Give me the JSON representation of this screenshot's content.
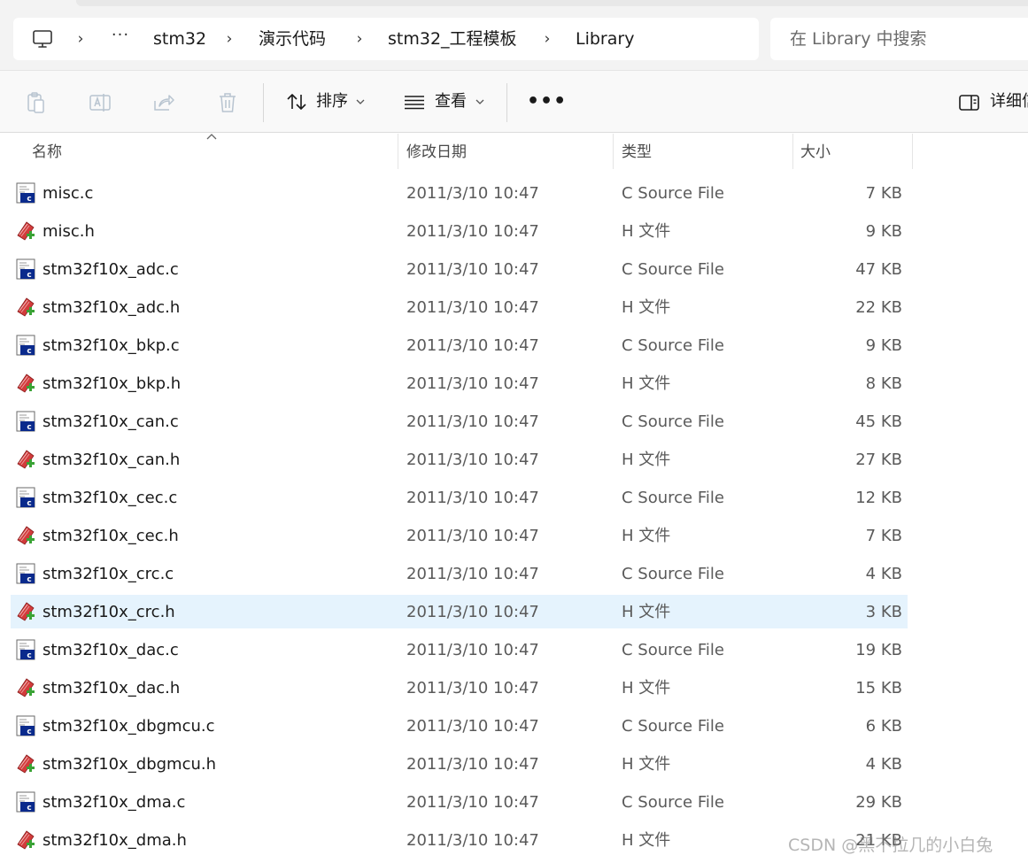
{
  "address": {
    "crumbs": [
      "stm32",
      "演示代码",
      "stm32_工程模板",
      "Library"
    ],
    "ellipsis": "···",
    "separator": "›"
  },
  "search": {
    "placeholder": "在 Library 中搜索"
  },
  "toolbar": {
    "sort_label": "排序",
    "view_label": "查看",
    "more_label": "•••",
    "details_label": "详细信息"
  },
  "columns": {
    "name": "名称",
    "date": "修改日期",
    "type": "类型",
    "size": "大小"
  },
  "files": [
    {
      "name": "misc.c",
      "date": "2011/3/10 10:47",
      "type": "C Source File",
      "size": "7 KB",
      "kind": "c"
    },
    {
      "name": "misc.h",
      "date": "2011/3/10 10:47",
      "type": "H 文件",
      "size": "9 KB",
      "kind": "h"
    },
    {
      "name": "stm32f10x_adc.c",
      "date": "2011/3/10 10:47",
      "type": "C Source File",
      "size": "47 KB",
      "kind": "c"
    },
    {
      "name": "stm32f10x_adc.h",
      "date": "2011/3/10 10:47",
      "type": "H 文件",
      "size": "22 KB",
      "kind": "h"
    },
    {
      "name": "stm32f10x_bkp.c",
      "date": "2011/3/10 10:47",
      "type": "C Source File",
      "size": "9 KB",
      "kind": "c"
    },
    {
      "name": "stm32f10x_bkp.h",
      "date": "2011/3/10 10:47",
      "type": "H 文件",
      "size": "8 KB",
      "kind": "h"
    },
    {
      "name": "stm32f10x_can.c",
      "date": "2011/3/10 10:47",
      "type": "C Source File",
      "size": "45 KB",
      "kind": "c"
    },
    {
      "name": "stm32f10x_can.h",
      "date": "2011/3/10 10:47",
      "type": "H 文件",
      "size": "27 KB",
      "kind": "h"
    },
    {
      "name": "stm32f10x_cec.c",
      "date": "2011/3/10 10:47",
      "type": "C Source File",
      "size": "12 KB",
      "kind": "c"
    },
    {
      "name": "stm32f10x_cec.h",
      "date": "2011/3/10 10:47",
      "type": "H 文件",
      "size": "7 KB",
      "kind": "h"
    },
    {
      "name": "stm32f10x_crc.c",
      "date": "2011/3/10 10:47",
      "type": "C Source File",
      "size": "4 KB",
      "kind": "c"
    },
    {
      "name": "stm32f10x_crc.h",
      "date": "2011/3/10 10:47",
      "type": "H 文件",
      "size": "3 KB",
      "kind": "h",
      "selected": true
    },
    {
      "name": "stm32f10x_dac.c",
      "date": "2011/3/10 10:47",
      "type": "C Source File",
      "size": "19 KB",
      "kind": "c"
    },
    {
      "name": "stm32f10x_dac.h",
      "date": "2011/3/10 10:47",
      "type": "H 文件",
      "size": "15 KB",
      "kind": "h"
    },
    {
      "name": "stm32f10x_dbgmcu.c",
      "date": "2011/3/10 10:47",
      "type": "C Source File",
      "size": "6 KB",
      "kind": "c"
    },
    {
      "name": "stm32f10x_dbgmcu.h",
      "date": "2011/3/10 10:47",
      "type": "H 文件",
      "size": "4 KB",
      "kind": "h"
    },
    {
      "name": "stm32f10x_dma.c",
      "date": "2011/3/10 10:47",
      "type": "C Source File",
      "size": "29 KB",
      "kind": "c"
    },
    {
      "name": "stm32f10x_dma.h",
      "date": "2011/3/10 10:47",
      "type": "H 文件",
      "size": "21 KB",
      "kind": "h"
    }
  ],
  "watermark": "CSDN @黑不拉几的小白兔",
  "colors": {
    "selection": "#e5f3fd",
    "c_icon_blue": "#0a2a8c",
    "h_icon_red": "#d23b3b",
    "h_icon_green": "#3aa335"
  }
}
